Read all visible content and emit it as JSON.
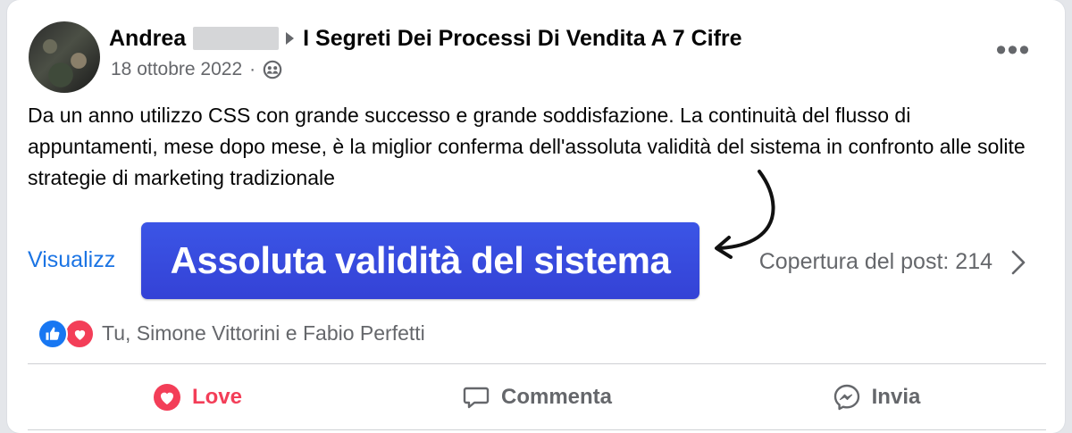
{
  "post": {
    "author": "Andrea",
    "group_name": "I Segreti Dei Processi Di Vendita A 7 Cifre",
    "date": "18 ottobre 2022",
    "separator": "·",
    "audience_icon": "friends-icon",
    "more_label": "•••",
    "text": "Da un anno utilizzo CSS con grande successo e grande soddisfazione. La continuità del flusso di appuntamenti, mese dopo mese, è la miglior conferma dell'assoluta validità del sistema in confronto alle solite strategie di marketing tradizionale"
  },
  "insights": {
    "link_label": "Visualizz",
    "reach_label": "Copertura del post: 214"
  },
  "overlay": {
    "highlight_text": "Assoluta validità del sistema",
    "highlight_color": "#3b4ee0"
  },
  "reactions": {
    "icons": [
      "like-icon",
      "love-icon"
    ],
    "names": "Tu, Simone Vittorini e Fabio Perfetti"
  },
  "actions": {
    "love_label": "Love",
    "comment_label": "Commenta",
    "send_label": "Invia"
  },
  "colors": {
    "link": "#1b74e4",
    "love": "#f33e58",
    "like": "#1877f2",
    "secondary_text": "#65676b"
  }
}
